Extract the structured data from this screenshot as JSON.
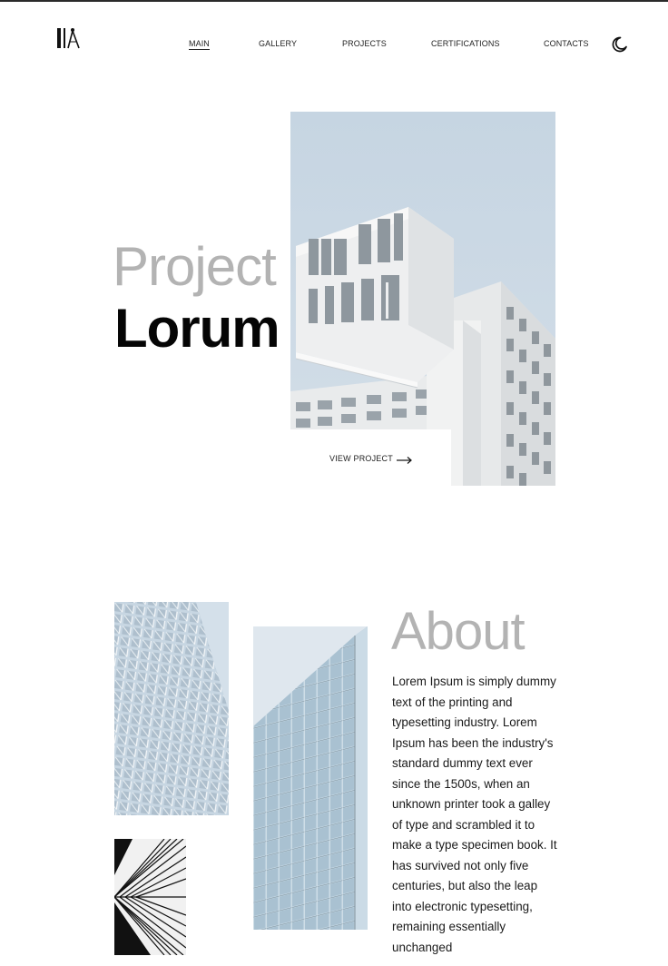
{
  "nav": {
    "items": [
      {
        "label": "MAIN",
        "active": true
      },
      {
        "label": "GALLERY",
        "active": false
      },
      {
        "label": "PROJECTS",
        "active": false
      },
      {
        "label": "CERTIFICATIONS",
        "active": false
      },
      {
        "label": "CONTACTS",
        "active": false
      }
    ],
    "theme_icon": "moon-icon",
    "logo_icon": "architect-tools-logo"
  },
  "hero": {
    "title_light": "Project",
    "title_bold": "Lorum",
    "cta_label": "VIEW PROJECT",
    "cta_icon": "arrow-right-icon"
  },
  "about": {
    "title": "About",
    "body": "Lorem Ipsum is simply dummy text of the printing and typesetting industry. Lorem Ipsum has been the industry's standard dummy text ever since the 1500s, when an unknown printer took a galley of type and scrambled it to make a type specimen book. It has survived not only five centuries, but also the leap into electronic typesetting, remaining essentially unchanged"
  },
  "colors": {
    "sky": "#c8d7e3",
    "accent_dark": "#050505",
    "muted_title": "#b3b3b3"
  }
}
